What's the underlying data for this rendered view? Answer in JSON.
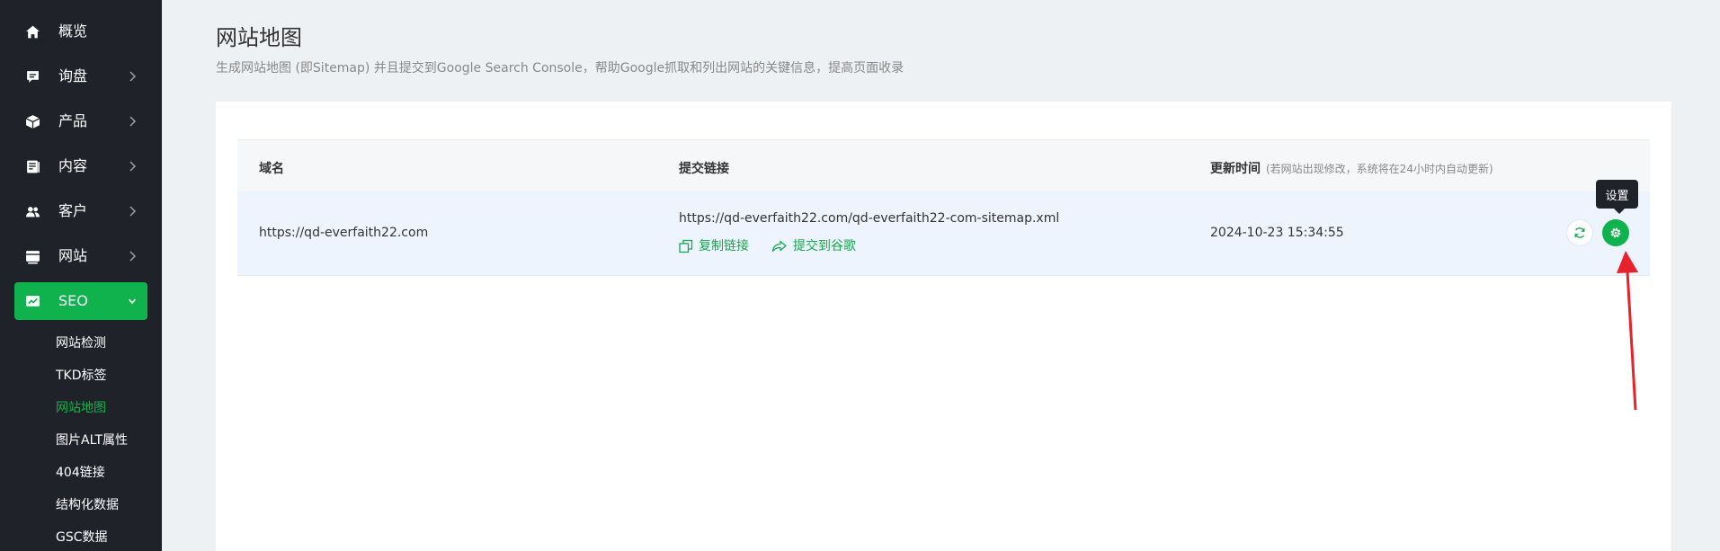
{
  "sidebar": {
    "items": [
      {
        "label": "概览",
        "icon": "home-icon"
      },
      {
        "label": "询盘",
        "icon": "inquiry-icon"
      },
      {
        "label": "产品",
        "icon": "product-box-icon"
      },
      {
        "label": "内容",
        "icon": "content-icon"
      },
      {
        "label": "客户",
        "icon": "customers-icon"
      },
      {
        "label": "网站",
        "icon": "website-icon"
      },
      {
        "label": "SEO",
        "icon": "seo-chart-icon"
      }
    ],
    "seo_sub_items": [
      "网站检测",
      "TKD标签",
      "网站地图",
      "图片ALT属性",
      "404链接",
      "结构化数据",
      "GSC数据"
    ],
    "active_item": "SEO",
    "active_sub_item": "网站地图"
  },
  "page": {
    "title": "网站地图",
    "description": "生成网站地图 (即Sitemap) 并且提交到Google Search Console，帮助Google抓取和列出网站的关键信息，提高页面收录"
  },
  "table": {
    "headers": {
      "domain": "域名",
      "submit_link": "提交链接",
      "updated_time": "更新时间",
      "updated_time_note": "(若网站出现修改，系统将在24小时内自动更新)"
    },
    "rows": [
      {
        "domain": "https://qd-everfaith22.com",
        "sitemap_url": "https://qd-everfaith22.com/qd-everfaith22-com-sitemap.xml",
        "copy_label": "复制链接",
        "submit_label": "提交到谷歌",
        "updated_time": "2024-10-23 15:34:55"
      }
    ]
  },
  "tooltip": {
    "settings": "设置"
  },
  "colors": {
    "sidebar_bg": "#1f2329",
    "accent_green": "#0fb24c",
    "row_highlight": "#edf4fd",
    "annotation_arrow": "#e8222b"
  }
}
